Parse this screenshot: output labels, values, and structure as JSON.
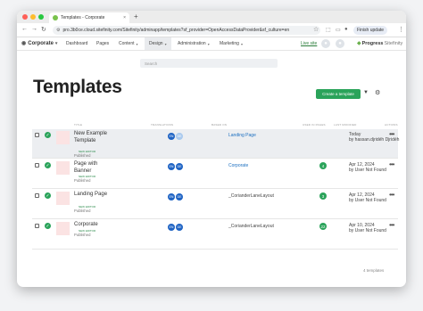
{
  "browser": {
    "tab_title": "Templates - Corporate",
    "tab_close": "×",
    "new_tab": "+",
    "url": "pro.3b0ce.cloud.sitefinity.com/Sitefinity/adminapp/templates?sf_provider=OpenAccessDataProvider&sf_culture=en",
    "finish_update": "Finish update"
  },
  "header": {
    "site_name": "Corporate",
    "nav": [
      {
        "label": "Dashboard",
        "has_menu": false
      },
      {
        "label": "Pages",
        "has_menu": false
      },
      {
        "label": "Content",
        "has_menu": true
      },
      {
        "label": "Design",
        "has_menu": true
      },
      {
        "label": "Administration",
        "has_menu": true
      },
      {
        "label": "Marketing",
        "has_menu": true
      }
    ],
    "live_site": "Live site",
    "logo_brand": "Progress",
    "logo_product": "Sitefinity"
  },
  "search": {
    "placeholder": "Search"
  },
  "page": {
    "title": "Templates",
    "create_button": "Create a template"
  },
  "table": {
    "columns": [
      "TITLE",
      "TRANSLATIONS",
      "BASED ON",
      "USED IN PAGES",
      "LAST MODIFIED",
      "ACTIONS"
    ],
    "rows": [
      {
        "title": "New Example Template",
        "badge": "NEW EDITOR",
        "status": "Published",
        "translations": [
          "EN",
          "DE"
        ],
        "second_translation_style": "light",
        "based_on": "Landing Page",
        "based_on_link": true,
        "used_in": "",
        "modified_date": "Today",
        "modified_by": "by hassan.djridéh Djridéh",
        "highlighted": true
      },
      {
        "title": "Page with Banner",
        "badge": "NEW EDITOR",
        "status": "Published",
        "translations": [
          "EN",
          "DE"
        ],
        "second_translation_style": "blue",
        "based_on": "Corporate",
        "based_on_link": true,
        "used_in": "4",
        "modified_date": "Apr 12, 2024",
        "modified_by": "by User Not Found",
        "highlighted": false
      },
      {
        "title": "Landing Page",
        "badge": "NEW EDITOR",
        "status": "Published",
        "translations": [
          "EN",
          "DE"
        ],
        "second_translation_style": "blue",
        "based_on": "_CorianderLaneLayout",
        "based_on_link": false,
        "used_in": "3",
        "modified_date": "Apr 12, 2024",
        "modified_by": "by User Not Found",
        "highlighted": false
      },
      {
        "title": "Corporate",
        "badge": "NEW EDITOR",
        "status": "Published",
        "translations": [
          "EN",
          "DE"
        ],
        "second_translation_style": "blue",
        "based_on": "_CorianderLaneLayout",
        "based_on_link": false,
        "used_in": "22",
        "modified_date": "Apr 10, 2024",
        "modified_by": "by User Not Found",
        "highlighted": false
      }
    ],
    "total": "4 templates"
  },
  "colors": {
    "accent_green": "#2aa35a",
    "link_blue": "#1a6ec0",
    "avatar_blue": "#1e63c4"
  }
}
